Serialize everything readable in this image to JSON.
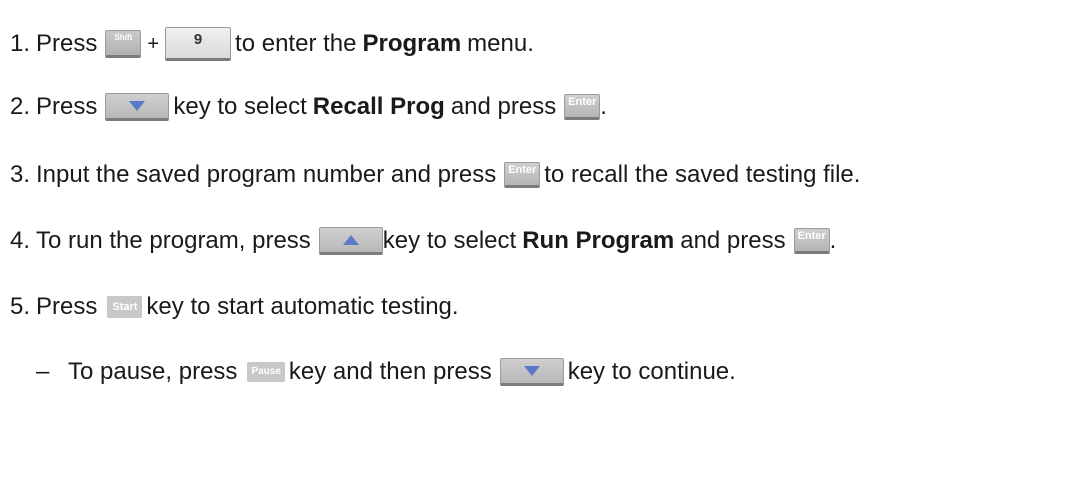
{
  "steps": [
    {
      "num": "1.",
      "t1": "Press",
      "t2": "+",
      "t3": "to enter the",
      "bold": "Program",
      "t4": "menu."
    },
    {
      "num": "2.",
      "t1": "Press",
      "t2": "key to select",
      "bold": "Recall Prog",
      "t3": "and press",
      "t4": "."
    },
    {
      "num": "3.",
      "t1": "Input the saved program number and press",
      "t2": "to recall the saved testing file."
    },
    {
      "num": "4.",
      "t1": "To run the program, press",
      "t2": "key to select",
      "bold": "Run Program",
      "t3": "and press",
      "t4": "."
    },
    {
      "num": "5.",
      "t1": "Press",
      "t2": "key to start automatic testing."
    }
  ],
  "sub": {
    "dash": "–",
    "t1": "To pause, press",
    "t2": "key and then press",
    "t3": "key to continue."
  },
  "keys": {
    "shift": "Shift",
    "nine": "9",
    "enter": "Enter",
    "start": "Start",
    "pause": "Pause",
    "down": "down-arrow-icon",
    "up": "up-arrow-icon"
  }
}
